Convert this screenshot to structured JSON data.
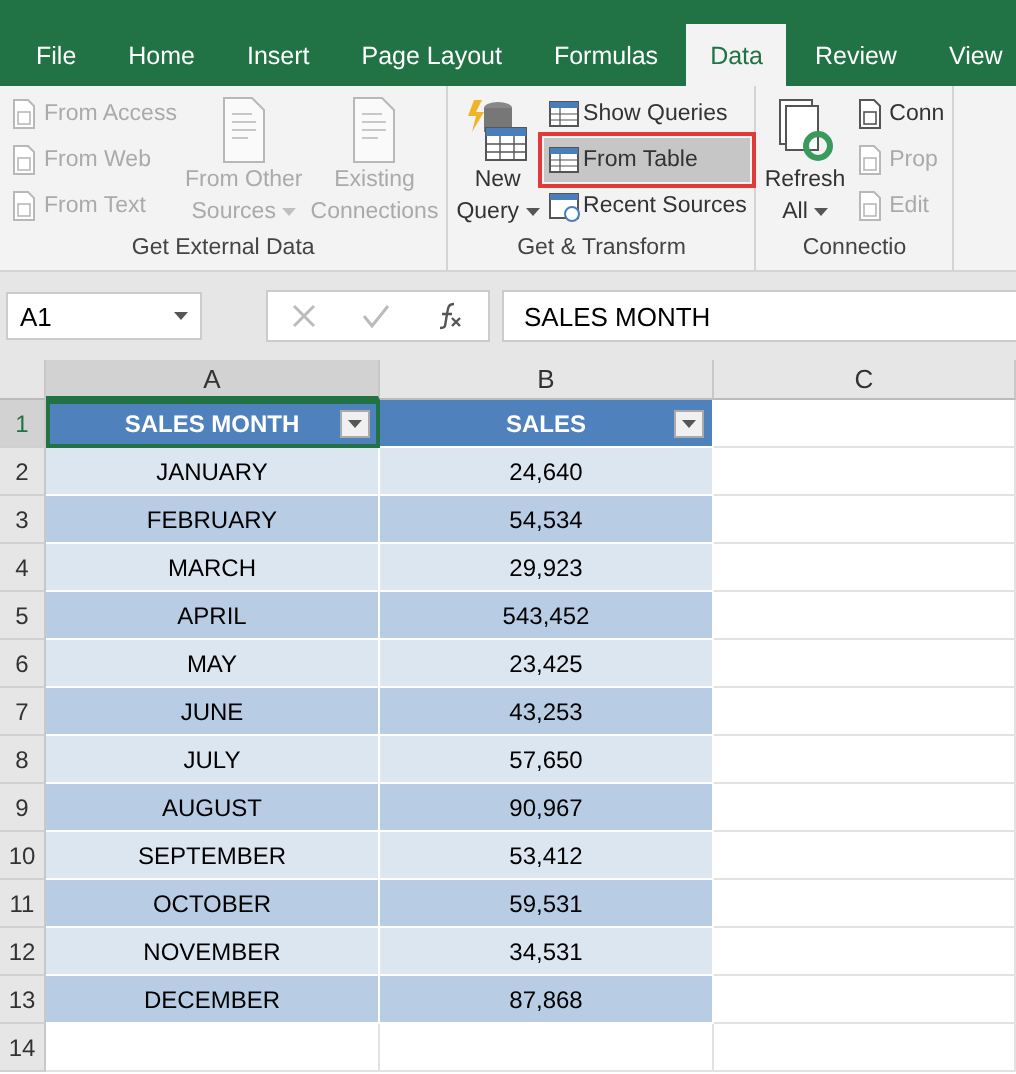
{
  "tabs": [
    {
      "label": "File",
      "selected": false
    },
    {
      "label": "Home",
      "selected": false
    },
    {
      "label": "Insert",
      "selected": false
    },
    {
      "label": "Page Layout",
      "selected": false
    },
    {
      "label": "Formulas",
      "selected": false
    },
    {
      "label": "Data",
      "selected": true
    },
    {
      "label": "Review",
      "selected": false
    },
    {
      "label": "View",
      "selected": false
    }
  ],
  "ribbon": {
    "groups": [
      {
        "label": "Get External Data",
        "items": [
          {
            "kind": "small",
            "label": "From Access",
            "disabled": true,
            "selected": false
          },
          {
            "kind": "small",
            "label": "From Web",
            "disabled": true,
            "selected": false
          },
          {
            "kind": "small",
            "label": "From Text",
            "disabled": true,
            "selected": false
          },
          {
            "kind": "large",
            "lines": [
              "From Other",
              "Sources"
            ],
            "dropdown": true,
            "disabled": true
          },
          {
            "kind": "large",
            "lines": [
              "Existing",
              "Connections"
            ],
            "dropdown": false,
            "disabled": true
          }
        ]
      },
      {
        "label": "Get & Transform",
        "items": [
          {
            "kind": "large",
            "lines": [
              "New",
              "Query"
            ],
            "dropdown": true,
            "disabled": false
          },
          {
            "kind": "small",
            "label": "Show Queries",
            "disabled": false,
            "selected": false
          },
          {
            "kind": "small",
            "label": "From Table",
            "disabled": false,
            "selected": true
          },
          {
            "kind": "small",
            "label": "Recent Sources",
            "disabled": false,
            "selected": false
          }
        ]
      },
      {
        "label": "Connectio",
        "items": [
          {
            "kind": "large",
            "lines": [
              "Refresh",
              "All"
            ],
            "dropdown": true,
            "disabled": false
          },
          {
            "kind": "small",
            "label": "Conn",
            "disabled": false,
            "selected": false
          },
          {
            "kind": "small",
            "label": "Prop",
            "disabled": true,
            "selected": false
          },
          {
            "kind": "small",
            "label": "Edit",
            "disabled": true,
            "selected": false
          }
        ]
      }
    ]
  },
  "formula_bar": {
    "name_box": "A1",
    "formula": "SALES MONTH"
  },
  "sheet": {
    "columns": [
      {
        "label": "A",
        "selected": true
      },
      {
        "label": "B",
        "selected": false
      },
      {
        "label": "C",
        "selected": false
      }
    ],
    "header": {
      "number": "1",
      "cells": [
        "SALES MONTH",
        "SALES"
      ]
    },
    "rows": [
      {
        "number": "2",
        "cells": [
          "JANUARY",
          "24,640"
        ]
      },
      {
        "number": "3",
        "cells": [
          "FEBRUARY",
          "54,534"
        ]
      },
      {
        "number": "4",
        "cells": [
          "MARCH",
          "29,923"
        ]
      },
      {
        "number": "5",
        "cells": [
          "APRIL",
          "543,452"
        ]
      },
      {
        "number": "6",
        "cells": [
          "MAY",
          "23,425"
        ]
      },
      {
        "number": "7",
        "cells": [
          "JUNE",
          "43,253"
        ]
      },
      {
        "number": "8",
        "cells": [
          "JULY",
          "57,650"
        ]
      },
      {
        "number": "9",
        "cells": [
          "AUGUST",
          "90,967"
        ]
      },
      {
        "number": "10",
        "cells": [
          "SEPTEMBER",
          "53,412"
        ]
      },
      {
        "number": "11",
        "cells": [
          "OCTOBER",
          "59,531"
        ]
      },
      {
        "number": "12",
        "cells": [
          "NOVEMBER",
          "34,531"
        ]
      },
      {
        "number": "13",
        "cells": [
          "DECEMBER",
          "87,868"
        ]
      }
    ],
    "empty_rows": [
      "14"
    ]
  }
}
